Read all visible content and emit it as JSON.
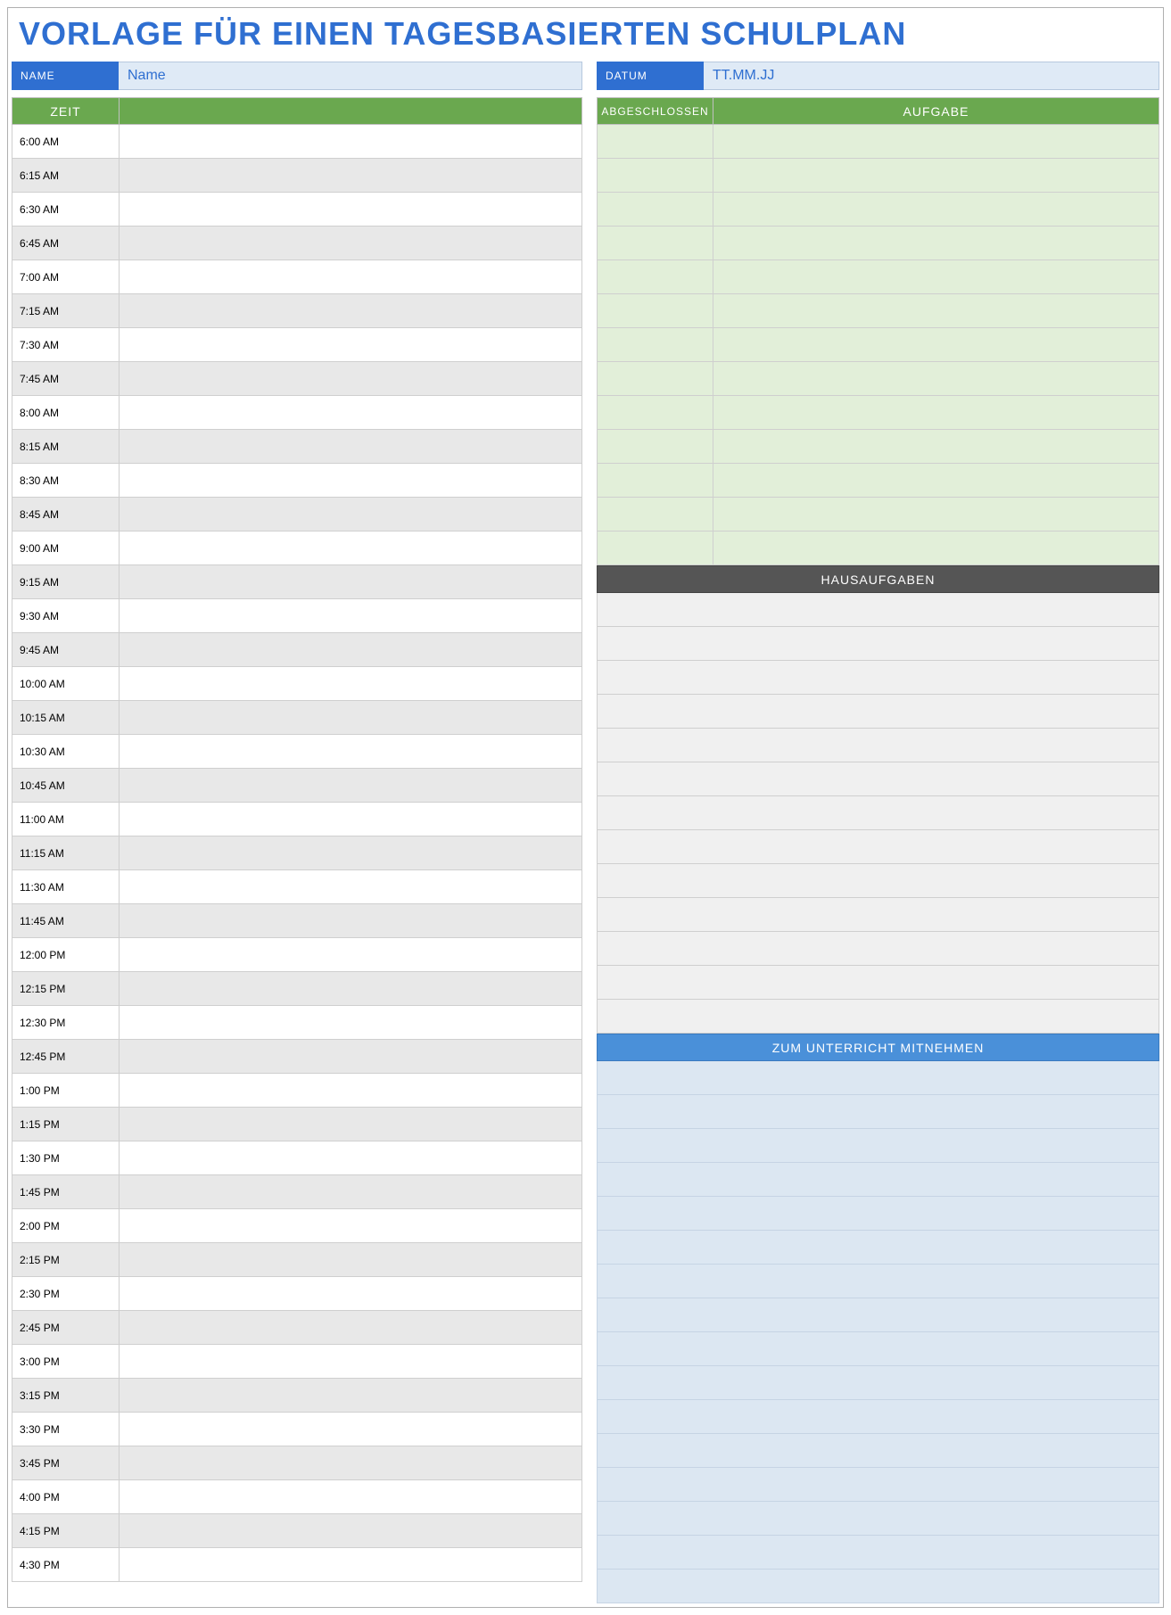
{
  "title": "VORLAGE FÜR EINEN TAGESBASIERTEN SCHULPLAN",
  "fields": {
    "name_label": "NAME",
    "name_value": "Name",
    "date_label": "DATUM",
    "date_value": "TT.MM.JJ"
  },
  "headers": {
    "zeit": "ZEIT",
    "abgeschlossen": "ABGESCHLOSSEN",
    "aufgabe": "AUFGABE",
    "hausaufgaben": "HAUSAUFGABEN",
    "mitnehmen": "ZUM UNTERRICHT MITNEHMEN"
  },
  "times": [
    "6:00 AM",
    "6:15 AM",
    "6:30 AM",
    "6:45 AM",
    "7:00 AM",
    "7:15 AM",
    "7:30 AM",
    "7:45 AM",
    "8:00 AM",
    "8:15 AM",
    "8:30 AM",
    "8:45 AM",
    "9:00 AM",
    "9:15 AM",
    "9:30 AM",
    "9:45 AM",
    "10:00 AM",
    "10:15 AM",
    "10:30 AM",
    "10:45 AM",
    "11:00 AM",
    "11:15 AM",
    "11:30 AM",
    "11:45 AM",
    "12:00 PM",
    "12:15 PM",
    "12:30 PM",
    "12:45 PM",
    "1:00 PM",
    "1:15 PM",
    "1:30 PM",
    "1:45 PM",
    "2:00 PM",
    "2:15 PM",
    "2:30 PM",
    "2:45 PM",
    "3:00 PM",
    "3:15 PM",
    "3:30 PM",
    "3:45 PM",
    "4:00 PM",
    "4:15 PM",
    "4:30 PM"
  ],
  "task_rows": 13,
  "homework_rows": 13,
  "bring_rows": 16
}
